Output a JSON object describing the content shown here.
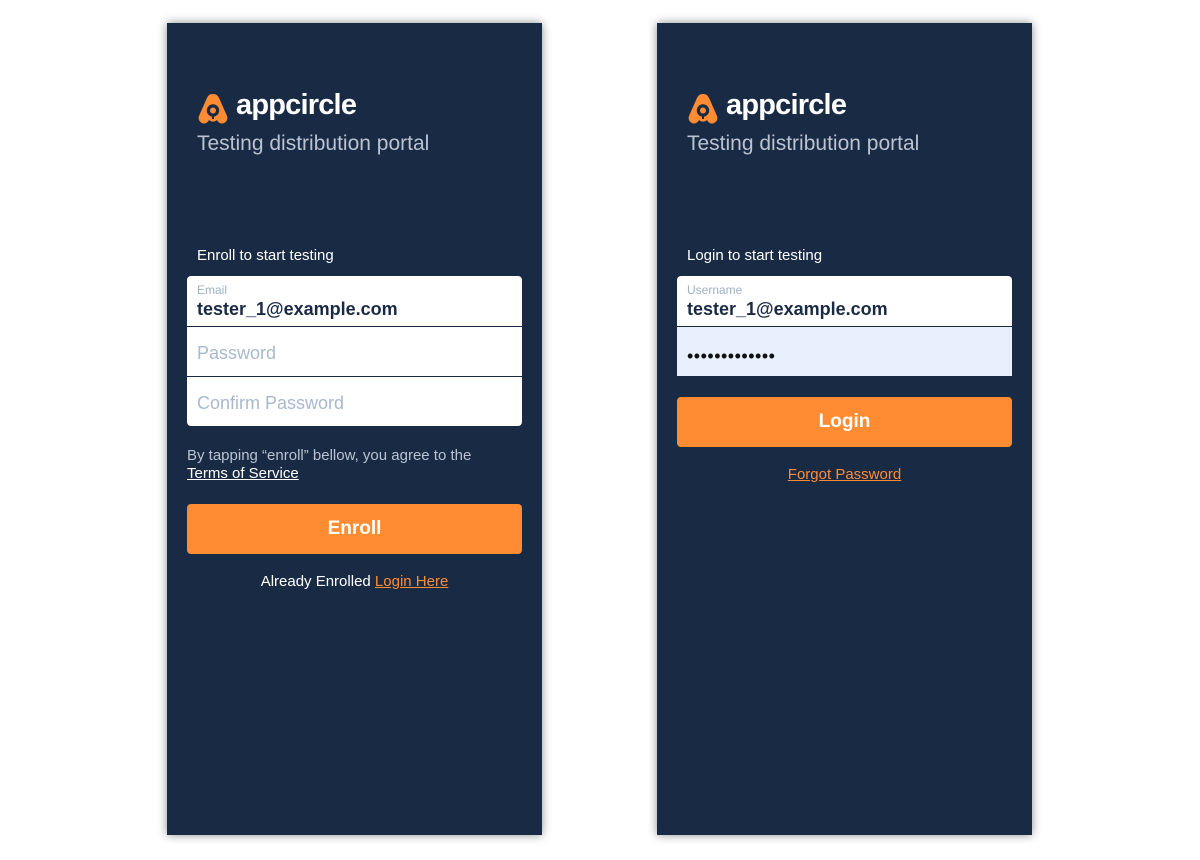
{
  "colors": {
    "background": "#192a44",
    "accent": "#ff8c33",
    "subtitle": "#b9c3d2",
    "autofill": "#e8f0fe"
  },
  "brand": {
    "wordmark": "appcircle",
    "subtitle": "Testing distribution portal",
    "icon": "appcircle-logo-icon"
  },
  "enroll": {
    "heading": "Enroll to start testing",
    "email_label": "Email",
    "email_value": "tester_1@example.com",
    "password_placeholder": "Password",
    "confirm_placeholder": "Confirm Password",
    "terms_text": "By tapping “enroll” bellow, you agree to the",
    "terms_link": "Terms of Service",
    "button": "Enroll",
    "already_text": "Already Enrolled",
    "login_link": "Login Here"
  },
  "login": {
    "heading": "Login to start testing",
    "username_label": "Username",
    "username_value": "tester_1@example.com",
    "password_masked": "•••••••••••••",
    "button": "Login",
    "forgot_link": "Forgot Password"
  }
}
